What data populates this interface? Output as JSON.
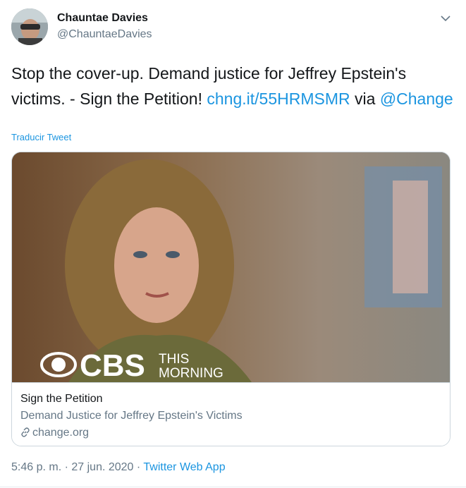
{
  "user": {
    "display_name": "Chauntae Davies",
    "handle": "@ChauntaeDavies"
  },
  "tweet": {
    "text_prefix": "Stop the cover-up. Demand justice for Jeffrey Epstein's victims. - Sign the Petition! ",
    "link": "chng.it/55HRMSMR",
    "via": " via ",
    "mention": "@Change",
    "translate_label": "Traducir Tweet"
  },
  "card": {
    "image_logo_text": "CBS",
    "image_logo_sub1": "THIS",
    "image_logo_sub2": "MORNING",
    "title": "Sign the Petition",
    "description": "Demand Justice for Jeffrey Epstein's Victims",
    "domain": "change.org",
    "icon": "link-icon"
  },
  "footer": {
    "time": "5:46 p. m.",
    "sep1": " · ",
    "date": "27 jun. 2020",
    "sep2": " · ",
    "source": "Twitter Web App"
  },
  "colors": {
    "link": "#1b95e0",
    "secondary": "#657786",
    "text": "#14171a",
    "border": "#ccd6dd"
  }
}
